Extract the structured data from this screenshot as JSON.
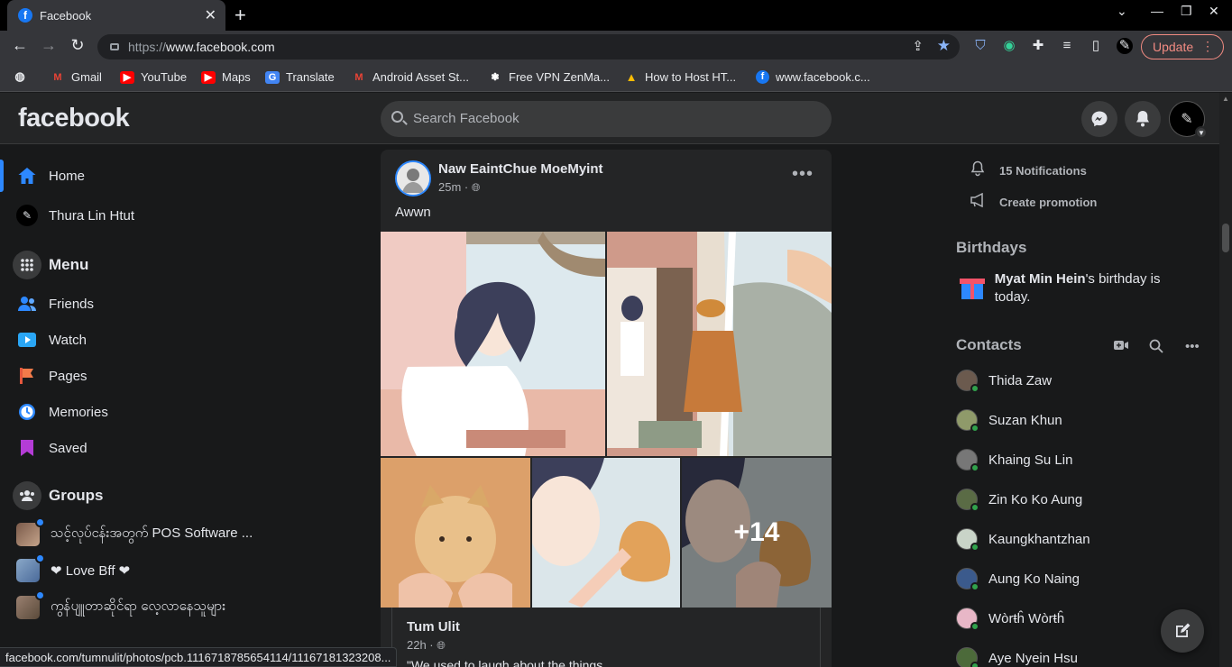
{
  "browser": {
    "tab_title": "Facebook",
    "url_scheme": "https://",
    "url_host": "www.facebook.com",
    "update_label": "Update",
    "bookmarks": [
      {
        "label": "Gmail",
        "icon": "gmail-icon",
        "color": "#ea4335"
      },
      {
        "label": "YouTube",
        "icon": "youtube-icon",
        "color": "#ff0000"
      },
      {
        "label": "Maps",
        "icon": "youtube-icon",
        "color": "#ff0000"
      },
      {
        "label": "Translate",
        "icon": "translate-icon",
        "color": "#4285f4"
      },
      {
        "label": "Android Asset St...",
        "icon": "gmail-icon",
        "color": "#ea4335"
      },
      {
        "label": "Free VPN ZenMa...",
        "icon": "zenmate-icon",
        "color": "#ffffff"
      },
      {
        "label": "How to Host HT...",
        "icon": "drive-icon",
        "color": "#fbbc04"
      },
      {
        "label": "www.facebook.c...",
        "icon": "facebook-icon",
        "color": "#1877f2"
      }
    ],
    "status_url": "facebook.com/tumnulit/photos/pcb.1116718785654114/11167181323208..."
  },
  "header": {
    "logo": "facebook",
    "search_placeholder": "Search Facebook"
  },
  "left_nav": {
    "items": [
      {
        "label": "Home",
        "icon": "home-icon"
      },
      {
        "label": "Thura Lin Htut",
        "icon": "avatar"
      }
    ],
    "menu_title": "Menu",
    "menu_items": [
      {
        "label": "Friends",
        "icon": "friends-icon"
      },
      {
        "label": "Watch",
        "icon": "watch-icon"
      },
      {
        "label": "Pages",
        "icon": "pages-icon"
      },
      {
        "label": "Memories",
        "icon": "memories-icon"
      },
      {
        "label": "Saved",
        "icon": "saved-icon"
      }
    ],
    "groups_title": "Groups",
    "groups": [
      {
        "label": "သင့်လုပ်ငန်းအတွက် POS Software ..."
      },
      {
        "label": "❤ Love Bff ❤"
      },
      {
        "label": "ကွန်ပျူတာဆိုင်ရာ လေ့လာနေသူများ"
      }
    ]
  },
  "post": {
    "author": "Naw EaintChue MoeMyint",
    "time": "25m ·",
    "text": "Awwn",
    "more_photos": "+14",
    "shared": {
      "author": "Tum Ulit",
      "time": "22h ·",
      "text": "\"We used to laugh about the things"
    }
  },
  "right_side": {
    "notifications": "15 Notifications",
    "create_promotion": "Create promotion",
    "birthdays_title": "Birthdays",
    "birthday_name": "Myat Min Hein",
    "birthday_rest": "'s birthday is today.",
    "contacts_title": "Contacts",
    "contacts": [
      {
        "name": "Thida Zaw",
        "color": "#6b5a4e"
      },
      {
        "name": "Suzan Khun",
        "color": "#8f9a6a"
      },
      {
        "name": "Khaing Su Lin",
        "color": "#777777"
      },
      {
        "name": "Zin Ko Ko Aung",
        "color": "#5a6b45"
      },
      {
        "name": "Kaungkhantzhan",
        "color": "#c9d4c8"
      },
      {
        "name": "Aung Ko Naing",
        "color": "#3b5a8c"
      },
      {
        "name": "Wòrŧĥ Wòrŧĥ",
        "color": "#e8b7c7"
      },
      {
        "name": "Aye Nyein Hsu",
        "color": "#4c6a3a"
      }
    ]
  }
}
